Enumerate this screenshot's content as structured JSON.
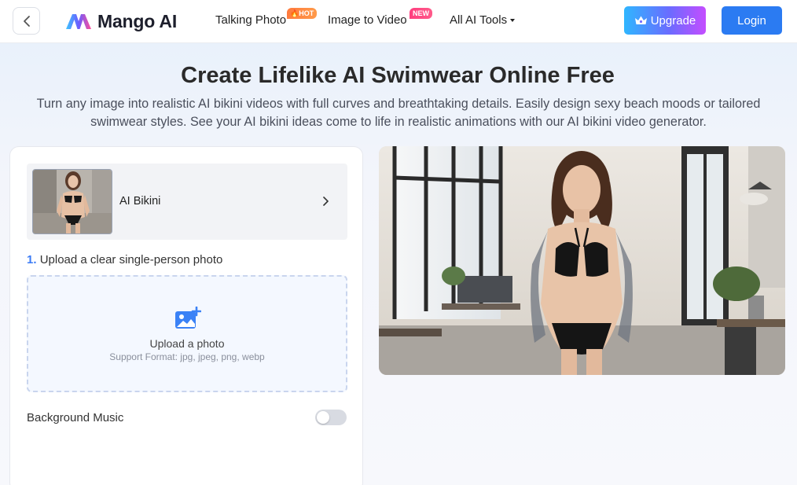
{
  "header": {
    "brand": "Mango AI",
    "nav": [
      {
        "label": "Talking Photo",
        "badge": "HOT"
      },
      {
        "label": "Image to Video",
        "badge": "NEW"
      },
      {
        "label": "All AI Tools"
      }
    ],
    "upgrade_label": "Upgrade",
    "login_label": "Login"
  },
  "hero": {
    "title": "Create Lifelike AI Swimwear Online Free",
    "description": "Turn any image into realistic AI bikini videos with full curves and breathtaking details. Easily design sexy beach moods or tailored swimwear styles. See your AI bikini ideas come to life in realistic animations with our AI bikini video generator."
  },
  "panel": {
    "template_name": "AI Bikini",
    "step_number": "1.",
    "step_text": "Upload a clear single-person photo",
    "upload_title": "Upload a photo",
    "upload_formats": "Support Format: jpg, jpeg, png, webp",
    "music_label": "Background Music",
    "music_enabled": false
  },
  "colors": {
    "primary": "#2b7bf2",
    "upload_bg": "#f4f8ff",
    "hot_badge": "#ff7a3d",
    "new_badge": "#ff3d7f"
  }
}
